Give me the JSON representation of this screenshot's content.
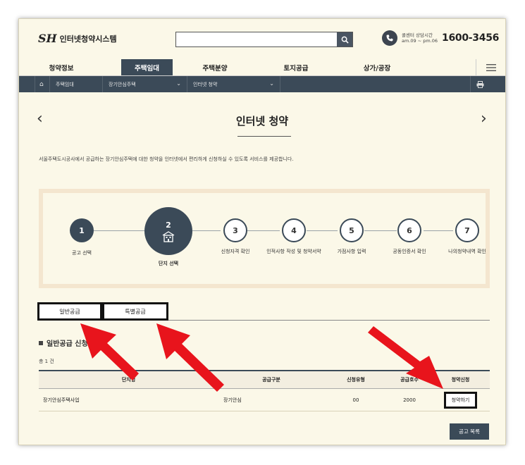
{
  "header": {
    "logo_mark": "SH",
    "logo_text": "인터넷청약시스템",
    "search_placeholder": "",
    "call_label_1": "콜센터 상담시간",
    "call_label_2": "am.09 ~ pm.06",
    "call_number": "1600-3456"
  },
  "nav": {
    "items": [
      "청약정보",
      "주택임대",
      "주택분양",
      "토지공급",
      "상가/공장"
    ],
    "active_index": 1
  },
  "breadcrumb": {
    "home": "⌂",
    "level1": "주택임대",
    "level2": "장기안심주택",
    "level3": "인터넷 청약"
  },
  "page": {
    "title": "인터넷 청약",
    "description": "서울주택도시공사에서 공급하는 장기안심주택에 대한 청약을 인터넷에서 편리하게 신청하실 수 있도록 서비스를 제공합니다."
  },
  "steps": [
    {
      "num": "1",
      "label": "공고 선택"
    },
    {
      "num": "2",
      "label": "단지 선택"
    },
    {
      "num": "3",
      "label": "신청자격 확인"
    },
    {
      "num": "4",
      "label": "인적사항 작성 및 청약서약"
    },
    {
      "num": "5",
      "label": "가점사항 입력"
    },
    {
      "num": "6",
      "label": "공동인증서 확인"
    },
    {
      "num": "7",
      "label": "나의청약내역 확인"
    }
  ],
  "tabs": [
    "일반공급",
    "특별공급"
  ],
  "section": {
    "title": "일반공급 신청",
    "total": "총 1 건"
  },
  "table": {
    "headers": [
      "단지명",
      "공급구분",
      "신청유형",
      "공급호수",
      "청약신청"
    ],
    "rows": [
      {
        "name": "장기안심주택사업",
        "type": "장기안심",
        "apply_type": "00",
        "count": "2000",
        "button": "청약하기"
      }
    ]
  },
  "list_button": "공고 목록",
  "colors": {
    "accent": "#3b4a58",
    "background": "#fbf8e8",
    "annotation": "#e8141c"
  }
}
